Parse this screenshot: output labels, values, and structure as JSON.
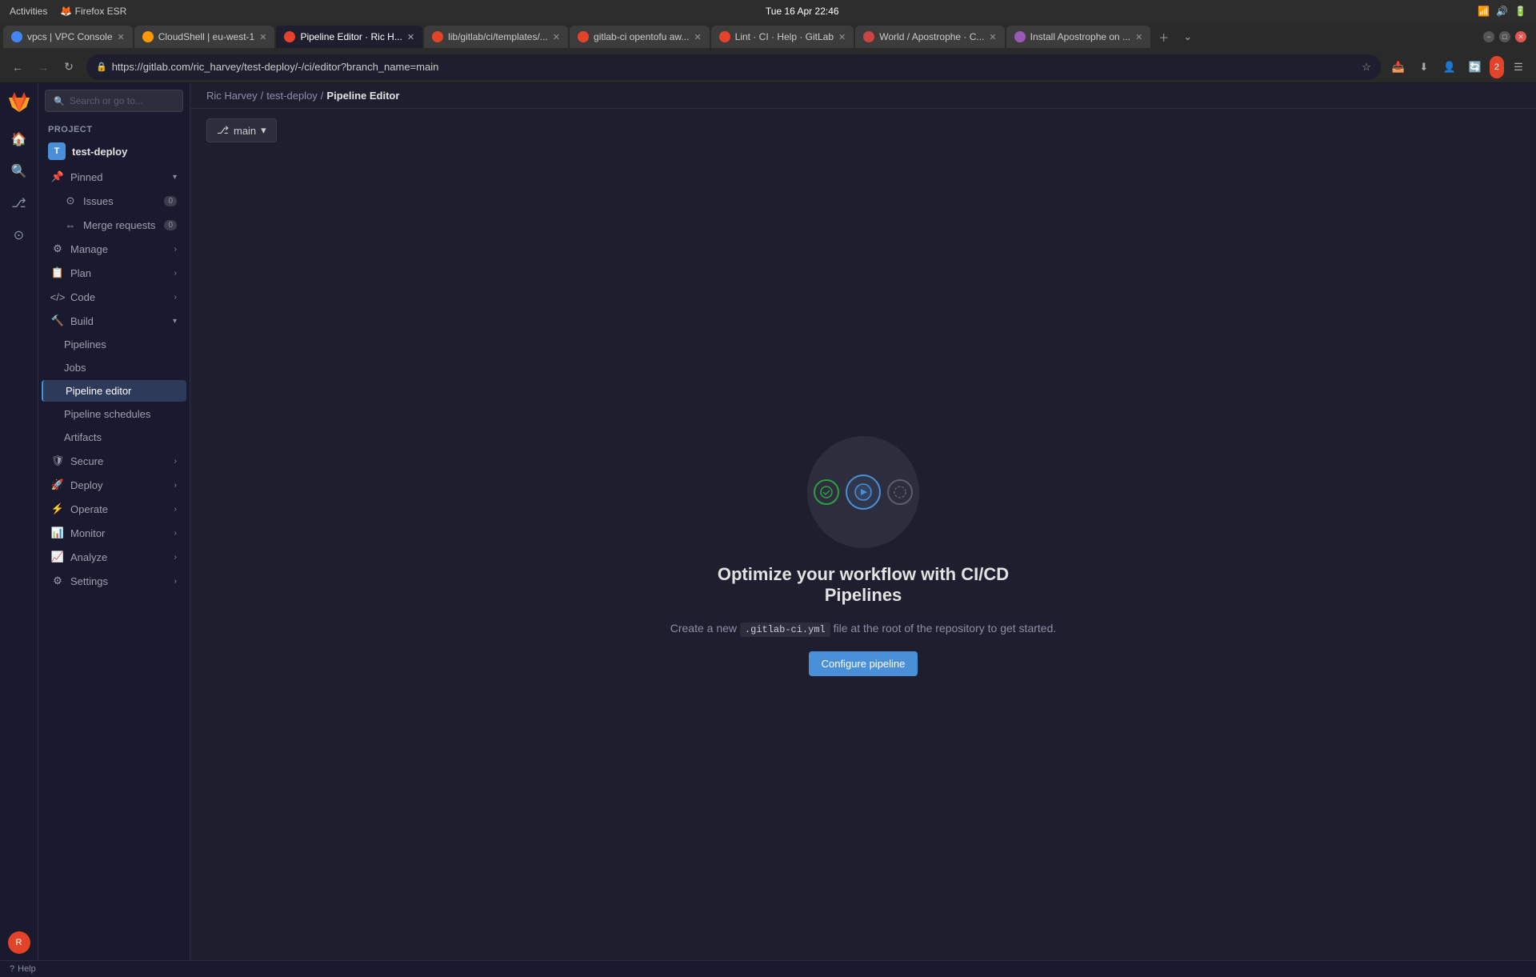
{
  "os": {
    "activities": "Activities",
    "browser_name": "Firefox ESR",
    "datetime": "Tue 16 Apr  22:46",
    "wifi_icon": "wifi",
    "sound_icon": "🔊",
    "battery_icon": "🔋"
  },
  "browser": {
    "url": "https://gitlab.com/ric_harvey/test-deploy/-/ci/editor?branch_name=main",
    "tabs": [
      {
        "id": "tab1",
        "title": "vpcs | VPC Console",
        "icon_color": "#4285f4",
        "icon_text": "G",
        "active": false
      },
      {
        "id": "tab2",
        "title": "CloudShell | eu-west-1",
        "icon_color": "#ff9900",
        "icon_text": "A",
        "active": false
      },
      {
        "id": "tab3",
        "title": "Pipeline Editor · Ric H...",
        "icon_color": "#e24329",
        "icon_text": "G",
        "active": true
      },
      {
        "id": "tab4",
        "title": "lib/gitlab/ci/templates/...",
        "icon_color": "#e24329",
        "icon_text": "G",
        "active": false
      },
      {
        "id": "tab5",
        "title": "gitlab-ci opentofu aw...",
        "icon_color": "#e24329",
        "icon_text": "G",
        "active": false
      },
      {
        "id": "tab6",
        "title": "Lint · CI · Help · GitLab",
        "icon_color": "#e24329",
        "icon_text": "G",
        "active": false
      },
      {
        "id": "tab7",
        "title": "World / Apostrophe · C...",
        "icon_color": "#cc4444",
        "icon_text": "A",
        "active": false
      },
      {
        "id": "tab8",
        "title": "Install Apostrophe on ...",
        "icon_color": "#9b59b6",
        "icon_text": "A",
        "active": false
      }
    ],
    "extensions_badge": "2",
    "back_btn": "←",
    "forward_btn": "→",
    "reload_btn": "↻"
  },
  "sidebar_narrow": {
    "home_icon": "🦊",
    "search_icon": "🔍",
    "merge_icon": "⇔",
    "issues_icon": "◎"
  },
  "breadcrumb": {
    "user": "Ric Harvey",
    "project": "test-deploy",
    "page": "Pipeline Editor",
    "sep": "/"
  },
  "toolbar": {
    "branch_icon": "⎇",
    "branch_name": "main",
    "branch_dropdown": "▾"
  },
  "sidebar": {
    "search_placeholder": "Search or go to...",
    "project_section": "Project",
    "project_name": "test-deploy",
    "project_icon_text": "T",
    "items": [
      {
        "id": "pinned",
        "label": "Pinned",
        "icon": "📌",
        "expandable": true,
        "expanded": true
      },
      {
        "id": "issues",
        "label": "Issues",
        "icon": "◎",
        "badge": "0",
        "sub": true
      },
      {
        "id": "merge-requests",
        "label": "Merge requests",
        "icon": "⇔",
        "badge": "0",
        "sub": true
      },
      {
        "id": "manage",
        "label": "Manage",
        "icon": "⚙",
        "expandable": true
      },
      {
        "id": "plan",
        "label": "Plan",
        "icon": "📋",
        "expandable": true
      },
      {
        "id": "code",
        "label": "Code",
        "icon": "{ }",
        "expandable": true
      },
      {
        "id": "build",
        "label": "Build",
        "icon": "🔨",
        "expandable": true,
        "expanded": true
      },
      {
        "id": "pipelines",
        "label": "Pipelines",
        "icon": "",
        "sub": true
      },
      {
        "id": "jobs",
        "label": "Jobs",
        "icon": "",
        "sub": true
      },
      {
        "id": "pipeline-editor",
        "label": "Pipeline editor",
        "icon": "",
        "sub": true,
        "active": true
      },
      {
        "id": "pipeline-schedules",
        "label": "Pipeline schedules",
        "icon": "",
        "sub": true
      },
      {
        "id": "artifacts",
        "label": "Artifacts",
        "icon": "",
        "sub": true
      },
      {
        "id": "secure",
        "label": "Secure",
        "icon": "🛡",
        "expandable": true
      },
      {
        "id": "deploy",
        "label": "Deploy",
        "icon": "🚀",
        "expandable": true
      },
      {
        "id": "operate",
        "label": "Operate",
        "icon": "⚡",
        "expandable": true
      },
      {
        "id": "monitor",
        "label": "Monitor",
        "icon": "📊",
        "expandable": true
      },
      {
        "id": "analyze",
        "label": "Analyze",
        "icon": "📈",
        "expandable": true
      },
      {
        "id": "settings",
        "label": "Settings",
        "icon": "⚙",
        "expandable": true
      }
    ]
  },
  "main": {
    "illustration_alt": "CI/CD Pipelines illustration",
    "title": "Optimize your workflow with CI/CD Pipelines",
    "description_prefix": "Create a new",
    "config_file": ".gitlab-ci.yml",
    "description_suffix": "file at the root of the repository to get started.",
    "configure_btn_label": "Configure pipeline"
  },
  "status_bar": {
    "help_label": "Help"
  }
}
